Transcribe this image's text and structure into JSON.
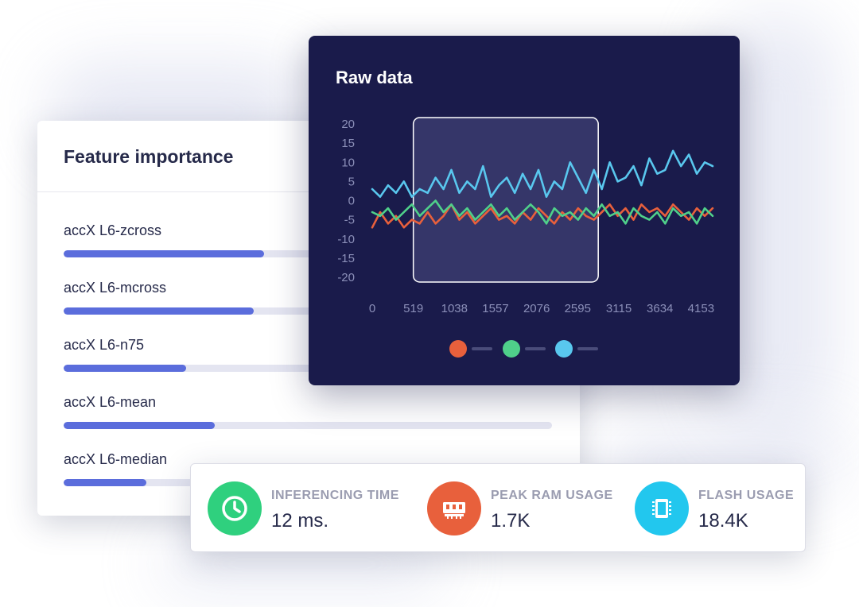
{
  "feature_importance": {
    "title": "Feature importance",
    "items": [
      {
        "label": "accX L6-zcross",
        "value": 0.41
      },
      {
        "label": "accX L6-mcross",
        "value": 0.39
      },
      {
        "label": "accX L6-n75",
        "value": 0.25
      },
      {
        "label": "accX L6-mean",
        "value": 0.31
      },
      {
        "label": "accX L6-median",
        "value": 0.17
      }
    ],
    "colors": {
      "fill": "#5b6ddc",
      "track": "#e4e5f1"
    }
  },
  "raw_data": {
    "title": "Raw data",
    "selection_window": {
      "x_start": 519,
      "x_end": 2855
    }
  },
  "chart_data": {
    "type": "line",
    "title": "Raw data",
    "xlabel": "",
    "ylabel": "",
    "xlim": [
      0,
      4300
    ],
    "ylim": [
      -20,
      20
    ],
    "x_ticks": [
      0,
      519,
      1038,
      1557,
      2076,
      2595,
      3115,
      3634,
      4153
    ],
    "y_ticks": [
      20,
      15,
      10,
      5,
      0,
      -5,
      -10,
      -15,
      -20
    ],
    "grid": false,
    "legend_position": "bottom-center",
    "x": [
      0,
      100,
      200,
      300,
      400,
      500,
      600,
      700,
      800,
      900,
      1000,
      1100,
      1200,
      1300,
      1400,
      1500,
      1600,
      1700,
      1800,
      1900,
      2000,
      2100,
      2200,
      2300,
      2400,
      2500,
      2600,
      2700,
      2800,
      2900,
      3000,
      3100,
      3200,
      3300,
      3400,
      3500,
      3600,
      3700,
      3800,
      3900,
      4000,
      4100,
      4200,
      4300
    ],
    "series": [
      {
        "color": "#e8603c",
        "values": [
          -7,
          -3,
          -6,
          -4,
          -7,
          -5,
          -6,
          -3,
          -6,
          -4,
          -1,
          -5,
          -3,
          -6,
          -4,
          -2,
          -5,
          -4,
          -6,
          -3,
          -5,
          -2,
          -4,
          -6,
          -3,
          -5,
          -2,
          -4,
          -5,
          -3,
          -1,
          -4,
          -2,
          -5,
          -1,
          -3,
          -2,
          -4,
          -1,
          -3,
          -5,
          -2,
          -4,
          -2
        ]
      },
      {
        "color": "#4fd08a",
        "values": [
          -3,
          -4,
          -2,
          -5,
          -3,
          -1,
          -4,
          -2,
          0,
          -3,
          -1,
          -4,
          -2,
          -5,
          -3,
          -1,
          -4,
          -2,
          -5,
          -3,
          -1,
          -3,
          -6,
          -2,
          -4,
          -3,
          -5,
          -2,
          -4,
          -1,
          -4,
          -3,
          -6,
          -2,
          -4,
          -5,
          -3,
          -6,
          -2,
          -4,
          -3,
          -6,
          -2,
          -4
        ]
      },
      {
        "color": "#59c7ee",
        "values": [
          3,
          1,
          4,
          2,
          5,
          1,
          3,
          2,
          6,
          3,
          8,
          2,
          5,
          3,
          9,
          1,
          4,
          6,
          2,
          7,
          3,
          8,
          1,
          5,
          3,
          10,
          6,
          2,
          8,
          3,
          10,
          5,
          6,
          9,
          4,
          11,
          7,
          8,
          13,
          9,
          12,
          7,
          10,
          9
        ]
      }
    ]
  },
  "metrics": [
    {
      "label": "INFERENCING TIME",
      "value": "12 ms.",
      "icon": "clock-icon",
      "color": "#2fd07e"
    },
    {
      "label": "PEAK RAM USAGE",
      "value": "1.7K",
      "icon": "ram-icon",
      "color": "#e8603c"
    },
    {
      "label": "FLASH USAGE",
      "value": "18.4K",
      "icon": "chip-icon",
      "color": "#22c7ee"
    }
  ]
}
